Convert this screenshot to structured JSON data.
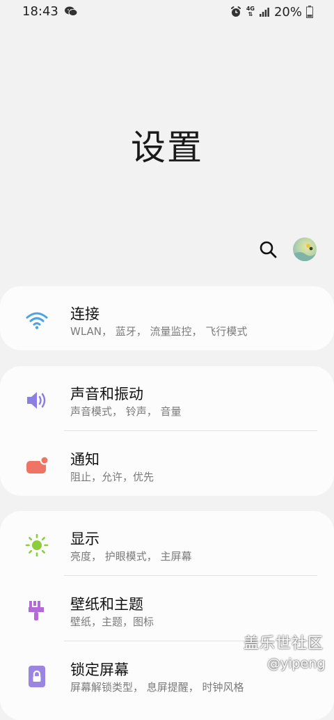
{
  "status_bar": {
    "time": "18:43",
    "network_label_top": "4G",
    "battery": "20%"
  },
  "page": {
    "title": "设置"
  },
  "icons": {
    "search": "search-icon",
    "avatar": "profile-avatar"
  },
  "groups": [
    {
      "items": [
        {
          "title": "连接",
          "subtitle": "WLAN， 蓝牙， 流量监控， 飞行模式",
          "icon": "wifi-icon",
          "color": "#4aa3e6"
        }
      ]
    },
    {
      "items": [
        {
          "title": "声音和振动",
          "subtitle": "声音模式， 铃声， 音量",
          "icon": "speaker-icon",
          "color": "#8b7fe0"
        },
        {
          "title": "通知",
          "subtitle": "阻止，允许，优先",
          "icon": "notification-icon",
          "color": "#ee7466"
        }
      ]
    },
    {
      "items": [
        {
          "title": "显示",
          "subtitle": "亮度， 护眼模式， 主屏幕",
          "icon": "brightness-icon",
          "color": "#8cce3a"
        },
        {
          "title": "壁纸和主题",
          "subtitle": "壁纸，主题，图标",
          "icon": "brush-icon",
          "color": "#b46ad9"
        },
        {
          "title": "锁定屏幕",
          "subtitle": "屏幕解锁类型， 息屏提醒， 时钟风格",
          "icon": "lock-icon",
          "color": "#9a86e0"
        }
      ]
    }
  ],
  "watermark": {
    "name": "盖乐世社区",
    "user": "@yipeng"
  }
}
